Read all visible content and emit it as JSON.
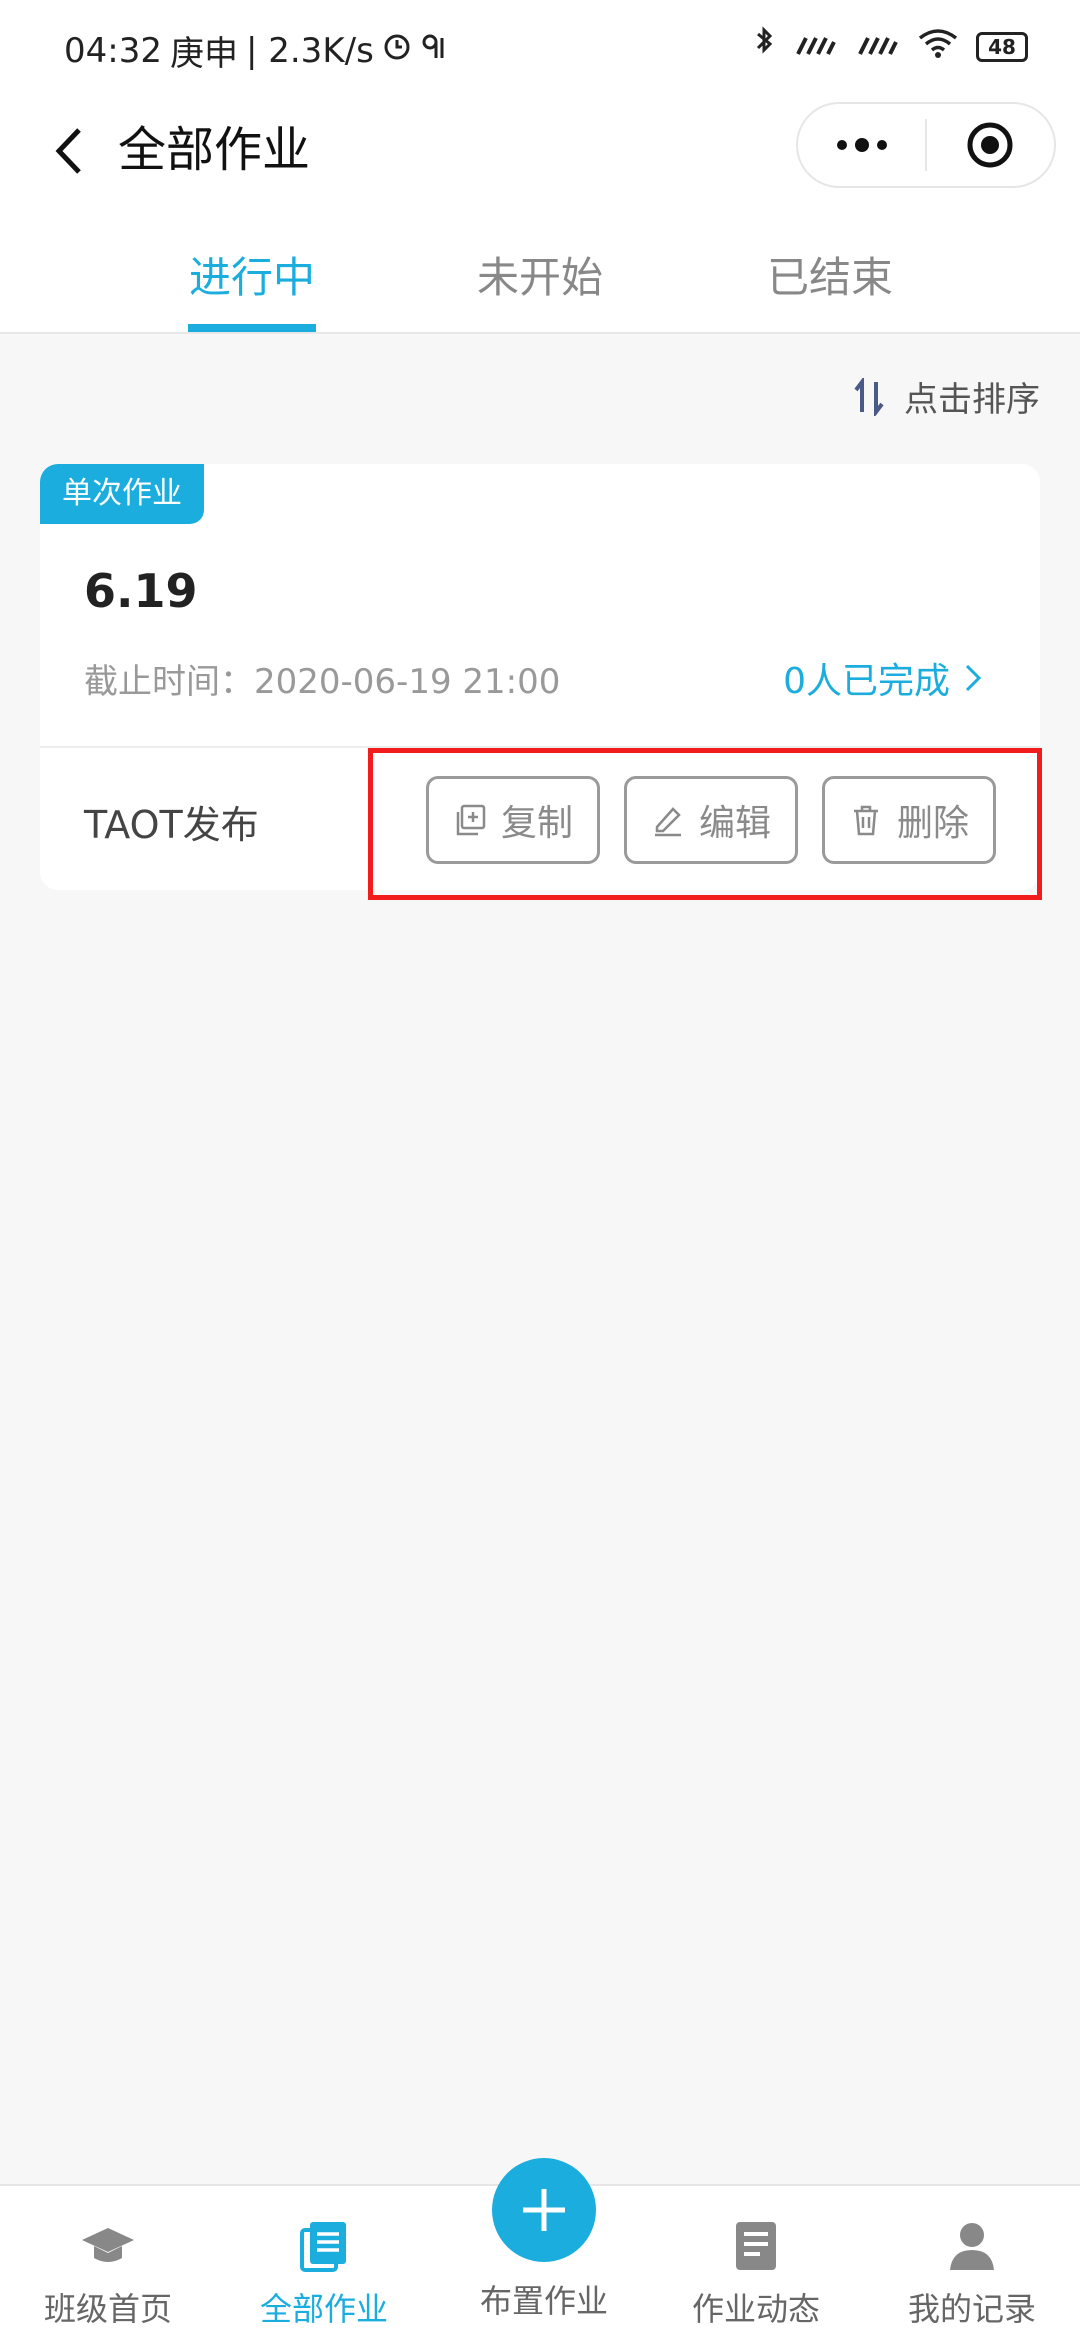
{
  "status_bar": {
    "time": "04:32",
    "lunar": "庚申",
    "speed": "| 2.3K/s",
    "battery": "48"
  },
  "nav": {
    "title": "全部作业"
  },
  "tabs": [
    {
      "label": "进行中",
      "active": true
    },
    {
      "label": "未开始",
      "active": false
    },
    {
      "label": "已结束",
      "active": false
    }
  ],
  "sort": {
    "label": "点击排序"
  },
  "card": {
    "badge": "单次作业",
    "title": "6.19",
    "deadline": "截止时间：2020-06-19 21:00",
    "completion": "0人已完成",
    "publisher": "TAOT发布",
    "actions": [
      {
        "label": "复制",
        "icon": "copy-icon"
      },
      {
        "label": "编辑",
        "icon": "edit-icon"
      },
      {
        "label": "删除",
        "icon": "trash-icon"
      }
    ]
  },
  "bottom_nav": [
    {
      "label": "班级首页",
      "icon": "graduation-cap-icon",
      "active": false
    },
    {
      "label": "全部作业",
      "icon": "document-list-icon",
      "active": true
    },
    {
      "label": "布置作业",
      "icon": "plus-icon",
      "active": false
    },
    {
      "label": "作业动态",
      "icon": "document-icon",
      "active": false
    },
    {
      "label": "我的记录",
      "icon": "user-icon",
      "active": false
    }
  ],
  "colors": {
    "accent": "#1aadde",
    "highlight": "#f21c1c"
  }
}
